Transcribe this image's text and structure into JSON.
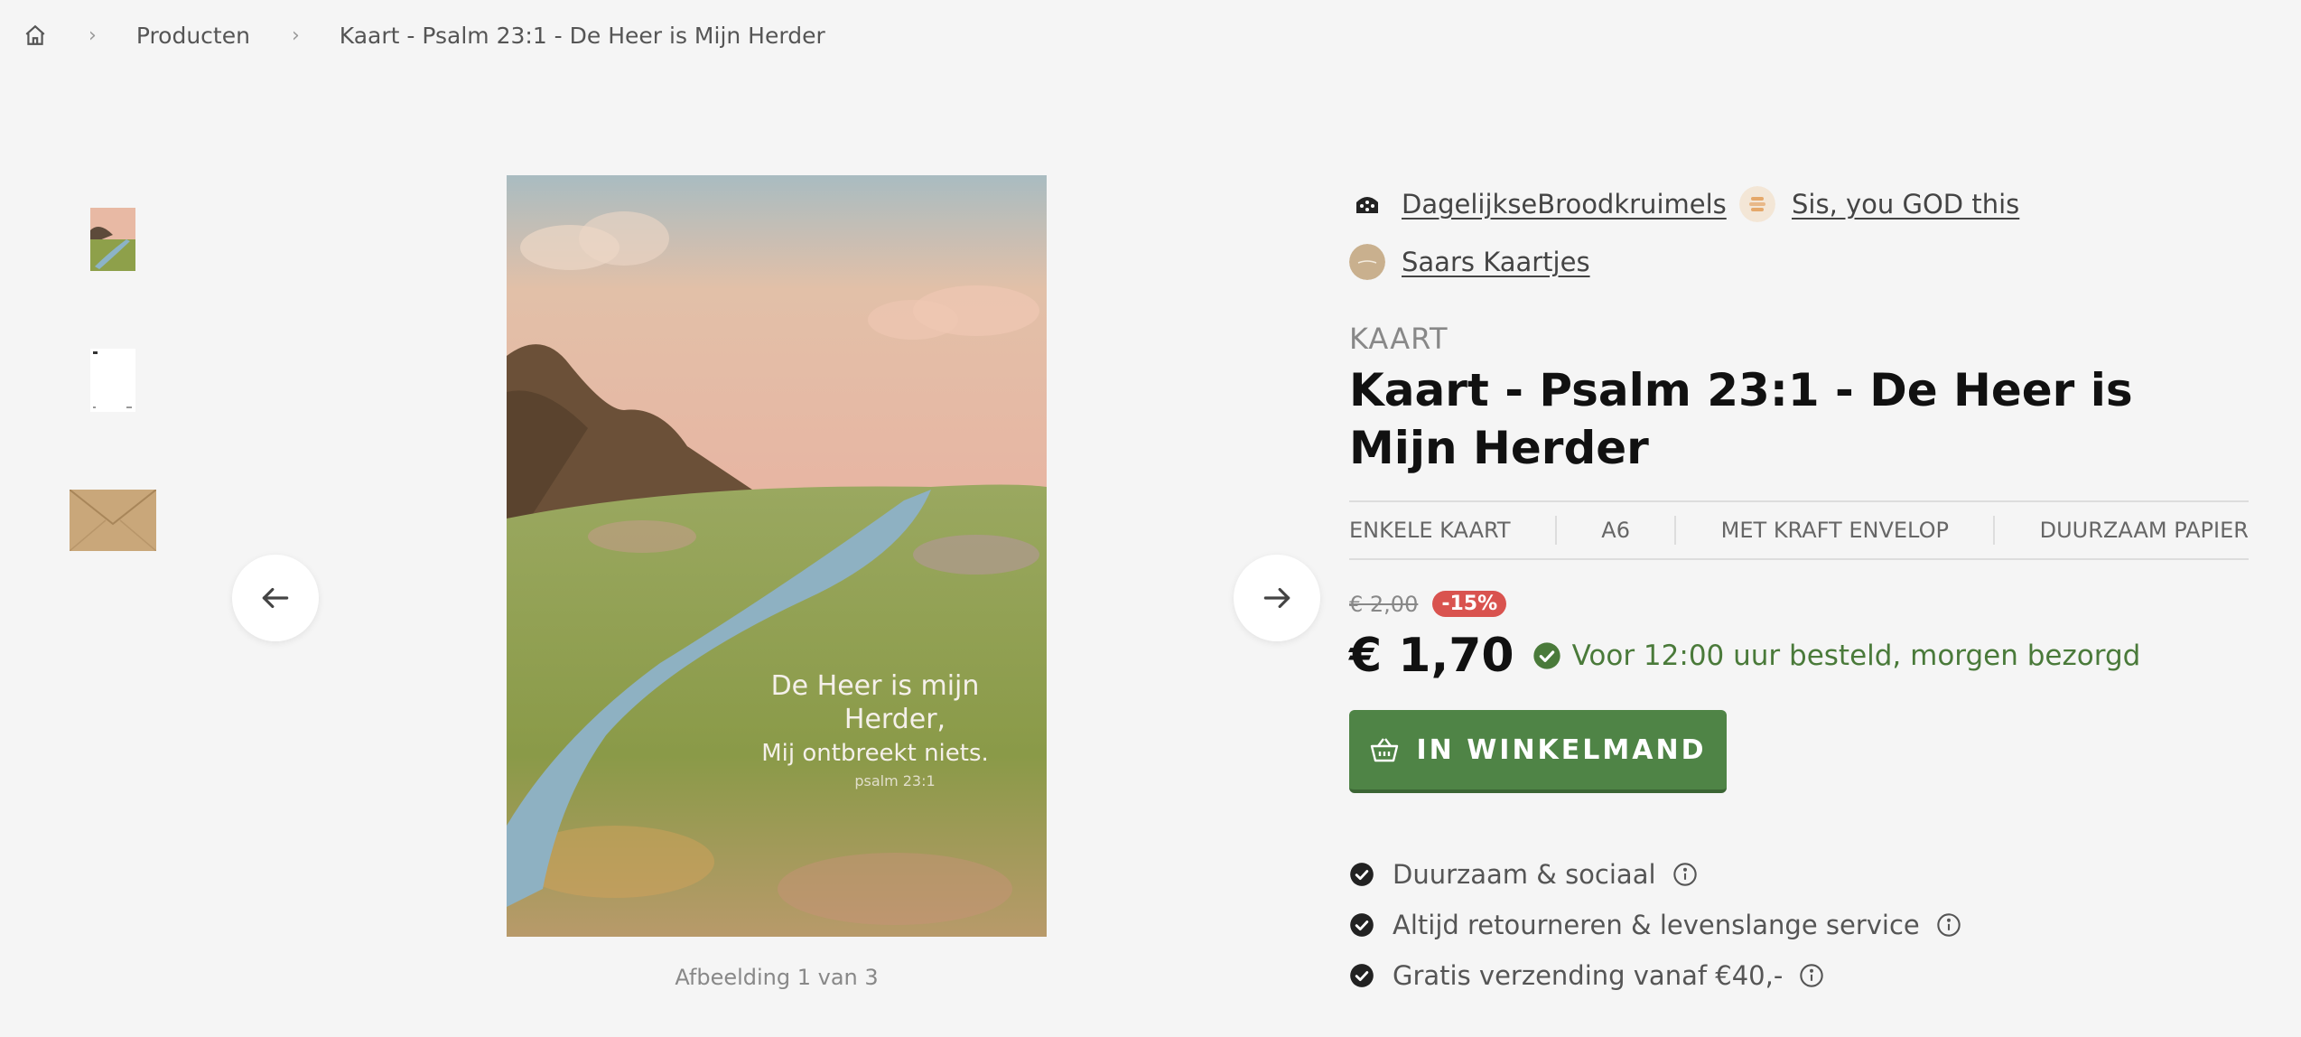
{
  "breadcrumb": {
    "home_icon": "home-icon",
    "items": [
      "Producten",
      "Kaart - Psalm 23:1 - De Heer is Mijn Herder"
    ]
  },
  "gallery": {
    "caption": "Afbeelding 1 van 3",
    "card_text": [
      "De Heer is mijn",
      "Herder,",
      "Mij ontbreekt niets.",
      "psalm 23:1"
    ]
  },
  "brands": [
    "DagelijkseBroodkruimels",
    "Sis, you GOD this",
    "Saars Kaartjes"
  ],
  "product": {
    "category": "KAART",
    "title": "Kaart - Psalm 23:1 - De Heer is Mijn Herder",
    "specs": [
      "ENKELE KAART",
      "A6",
      "MET KRAFT ENVELOP",
      "DUURZAAM PAPIER"
    ],
    "old_price": "€ 2,00",
    "discount": "-15%",
    "price": "€ 1,70",
    "delivery": "Voor 12:00 uur besteld, morgen bezorgd",
    "cart_label": "IN WINKELMAND"
  },
  "usps": [
    "Duurzaam & sociaal",
    "Altijd retourneren & levenslange service",
    "Gratis verzending vanaf €40,-"
  ],
  "colors": {
    "accent_green": "#4f8446",
    "delivery_green": "#4a7a3a",
    "discount_red": "#d9534f"
  }
}
